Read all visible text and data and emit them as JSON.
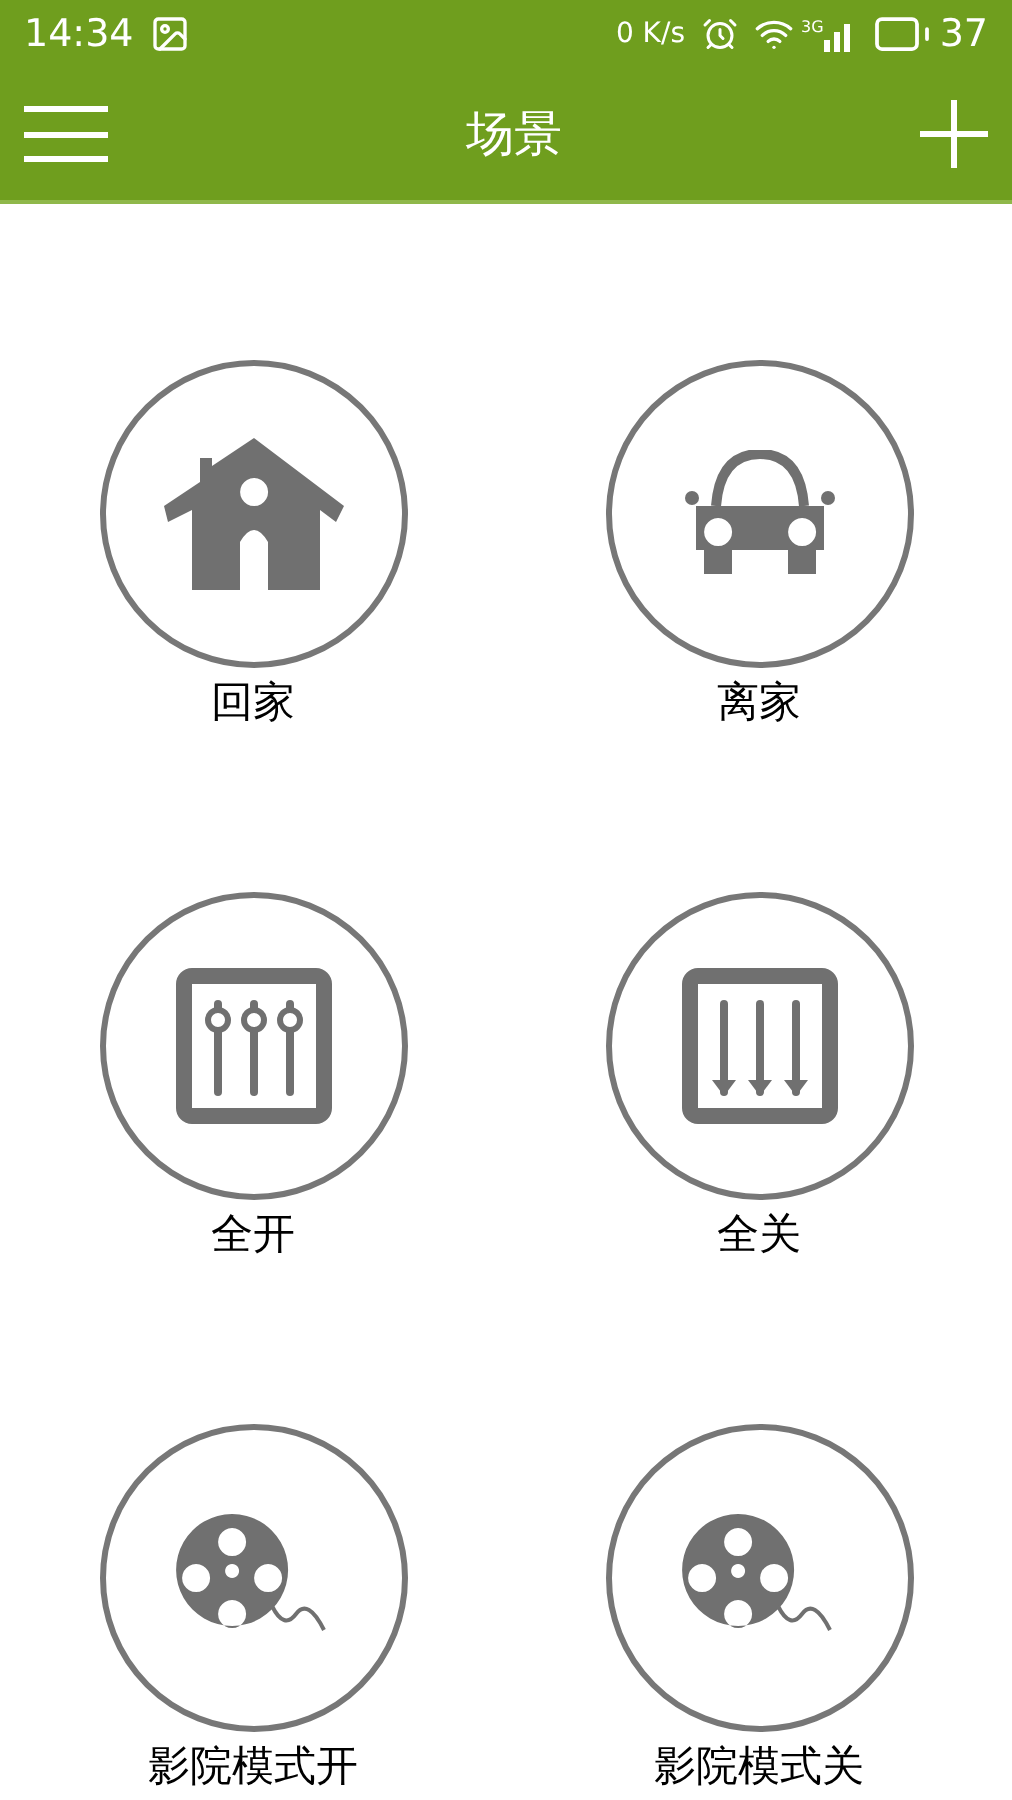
{
  "status_bar": {
    "time": "14:34",
    "net_speed": "0 K/s",
    "network": "3G",
    "battery": "37"
  },
  "app_bar": {
    "title": "场景"
  },
  "scenes": [
    {
      "label": "回家",
      "kind": "house"
    },
    {
      "label": "离家",
      "kind": "car"
    },
    {
      "label": "全开",
      "kind": "sliders-up"
    },
    {
      "label": "全关",
      "kind": "sliders-down"
    },
    {
      "label": "影院模式开",
      "kind": "film-reel"
    },
    {
      "label": "影院模式关",
      "kind": "film-reel"
    }
  ]
}
